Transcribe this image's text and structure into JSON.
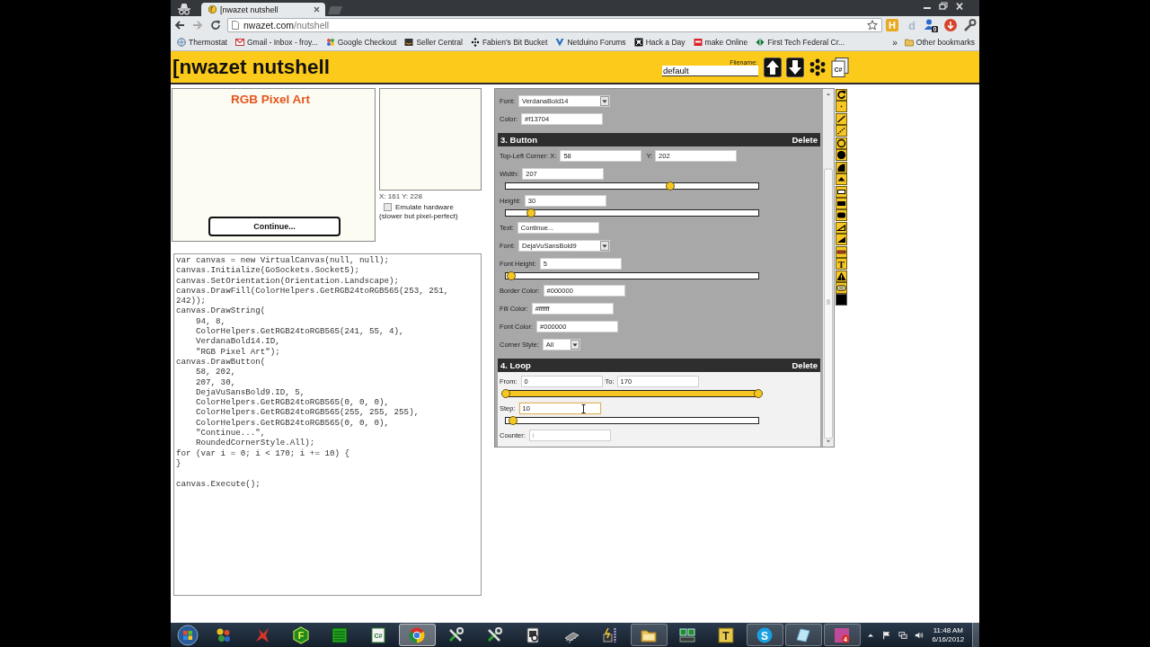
{
  "browser": {
    "tab_title": "[nwazet nutshell",
    "url_host": "nwazet.com",
    "url_path": "/nutshell",
    "extensions": [
      {
        "glyph": "H"
      },
      {
        "glyph": "d"
      },
      {
        "badge": "0"
      }
    ],
    "bookmarks": [
      {
        "label": "Thermostat"
      },
      {
        "label": "Gmail - Inbox - froy..."
      },
      {
        "label": "Google Checkout"
      },
      {
        "label": "Seller Central"
      },
      {
        "label": "Fabien's Bit Bucket"
      },
      {
        "label": "Netduino Forums"
      },
      {
        "label": "Hack a Day"
      },
      {
        "label": "make Online"
      },
      {
        "label": "First Tech Federal Cr..."
      }
    ],
    "more": "»",
    "other_bookmarks": "Other bookmarks"
  },
  "header": {
    "title": "[nwazet nutshell",
    "filename_label": "Filename:",
    "filename": "default",
    "code_badge": "C#"
  },
  "preview": {
    "title": "RGB Pixel Art",
    "button": "Continue...",
    "coordinates": "X: 161 Y: 228",
    "emulate_label": "Emulate hardware",
    "emulate_checked": false,
    "emulate_note": "(slower but pixel-perfect)"
  },
  "code": "var canvas = new VirtualCanvas(null, null);\ncanvas.Initialize(GoSockets.Socket5);\ncanvas.SetOrientation(Orientation.Landscape);\ncanvas.DrawFill(ColorHelpers.GetRGB24toRGB565(253, 251,\n242));\ncanvas.DrawString(\n    94, 8,\n    ColorHelpers.GetRGB24toRGB565(241, 55, 4),\n    VerdanaBold14.ID,\n    \"RGB Pixel Art\");\ncanvas.DrawButton(\n    58, 202,\n    207, 30,\n    DejaVuSansBold9.ID, 5,\n    ColorHelpers.GetRGB24toRGB565(0, 0, 0),\n    ColorHelpers.GetRGB24toRGB565(255, 255, 255),\n    ColorHelpers.GetRGB24toRGB565(0, 0, 0),\n    \"Continue...\",\n    RoundedCornerStyle.All);\nfor (var i = 0; i < 170; i += 10) {\n}\n\ncanvas.Execute();",
  "editor": {
    "sections": [
      {
        "selected": false,
        "rows": [
          {
            "kind": "select",
            "label": "Font:",
            "value": "VerdanaBold14",
            "focused": false
          },
          {
            "kind": "field",
            "label": "Color:",
            "value": "#f13704",
            "focused": false
          }
        ]
      },
      {
        "title": "3. Button",
        "action": "Delete",
        "selected": false,
        "rows": [
          {
            "kind": "pair",
            "label": "Top-Left Corner: X:",
            "value": "58",
            "label_2": "Y:",
            "value_2": "202",
            "focused": false
          },
          {
            "kind": "slider",
            "label": "Width:",
            "value": "207",
            "level": 0.65,
            "focused": false
          },
          {
            "kind": "slider",
            "label": "Height:",
            "value": "30",
            "level": 0.1,
            "focused": false
          },
          {
            "kind": "field",
            "label": "Text:",
            "value": "Continue...",
            "focused": false
          },
          {
            "kind": "select",
            "label": "Font:",
            "value": "DejaVuSansBold9",
            "focused": false
          },
          {
            "kind": "slider",
            "label": "Font Height:",
            "value": "5",
            "level": 0.02,
            "focused": false
          },
          {
            "kind": "field",
            "label": "Border Color:",
            "value": "#000000",
            "focused": false
          },
          {
            "kind": "field",
            "label": "Fill Color:",
            "value": "#ffffff",
            "focused": false
          },
          {
            "kind": "field",
            "label": "Font Color:",
            "value": "#000000",
            "focused": false
          },
          {
            "kind": "select",
            "label": "Corner Style:",
            "value": "All",
            "focused": false
          }
        ]
      },
      {
        "title": "4. Loop",
        "action": "Delete",
        "selected": true,
        "rows": [
          {
            "kind": "range",
            "label": "From:",
            "value": "0",
            "label_2": "To:",
            "value_2": "170",
            "thumbs": [
              {
                "level": 0
              },
              {
                "level": 1
              }
            ],
            "focused": false
          },
          {
            "kind": "slider",
            "label": "Step:",
            "value": "10",
            "level": 0.03,
            "focused": true
          },
          {
            "kind": "field",
            "label": "Counter:",
            "placeholder": "i",
            "focused": false
          }
        ]
      }
    ]
  },
  "toolbar": {
    "text_tool": "T"
  },
  "taskbar": {
    "buttons": [
      {
        "open": false,
        "selected": false
      },
      {
        "open": false,
        "selected": false
      },
      {
        "open": false,
        "selected": false,
        "glyph": "F"
      },
      {
        "open": false,
        "selected": false
      },
      {
        "open": false,
        "selected": false,
        "glyph": "C#"
      },
      {
        "open": true,
        "selected": true
      },
      {
        "open": false,
        "selected": false
      },
      {
        "open": false,
        "selected": false
      },
      {
        "open": false,
        "selected": false
      },
      {
        "open": false,
        "selected": false
      },
      {
        "open": false,
        "selected": false
      },
      {
        "open": true,
        "selected": false
      },
      {
        "open": false,
        "selected": false
      },
      {
        "open": false,
        "selected": false,
        "glyph": "T"
      },
      {
        "open": true,
        "selected": false,
        "glyph": "S"
      },
      {
        "open": true,
        "selected": false
      },
      {
        "open": true,
        "selected": false,
        "glyph": "4"
      }
    ],
    "time": "11:48 AM",
    "date": "6/16/2012"
  }
}
